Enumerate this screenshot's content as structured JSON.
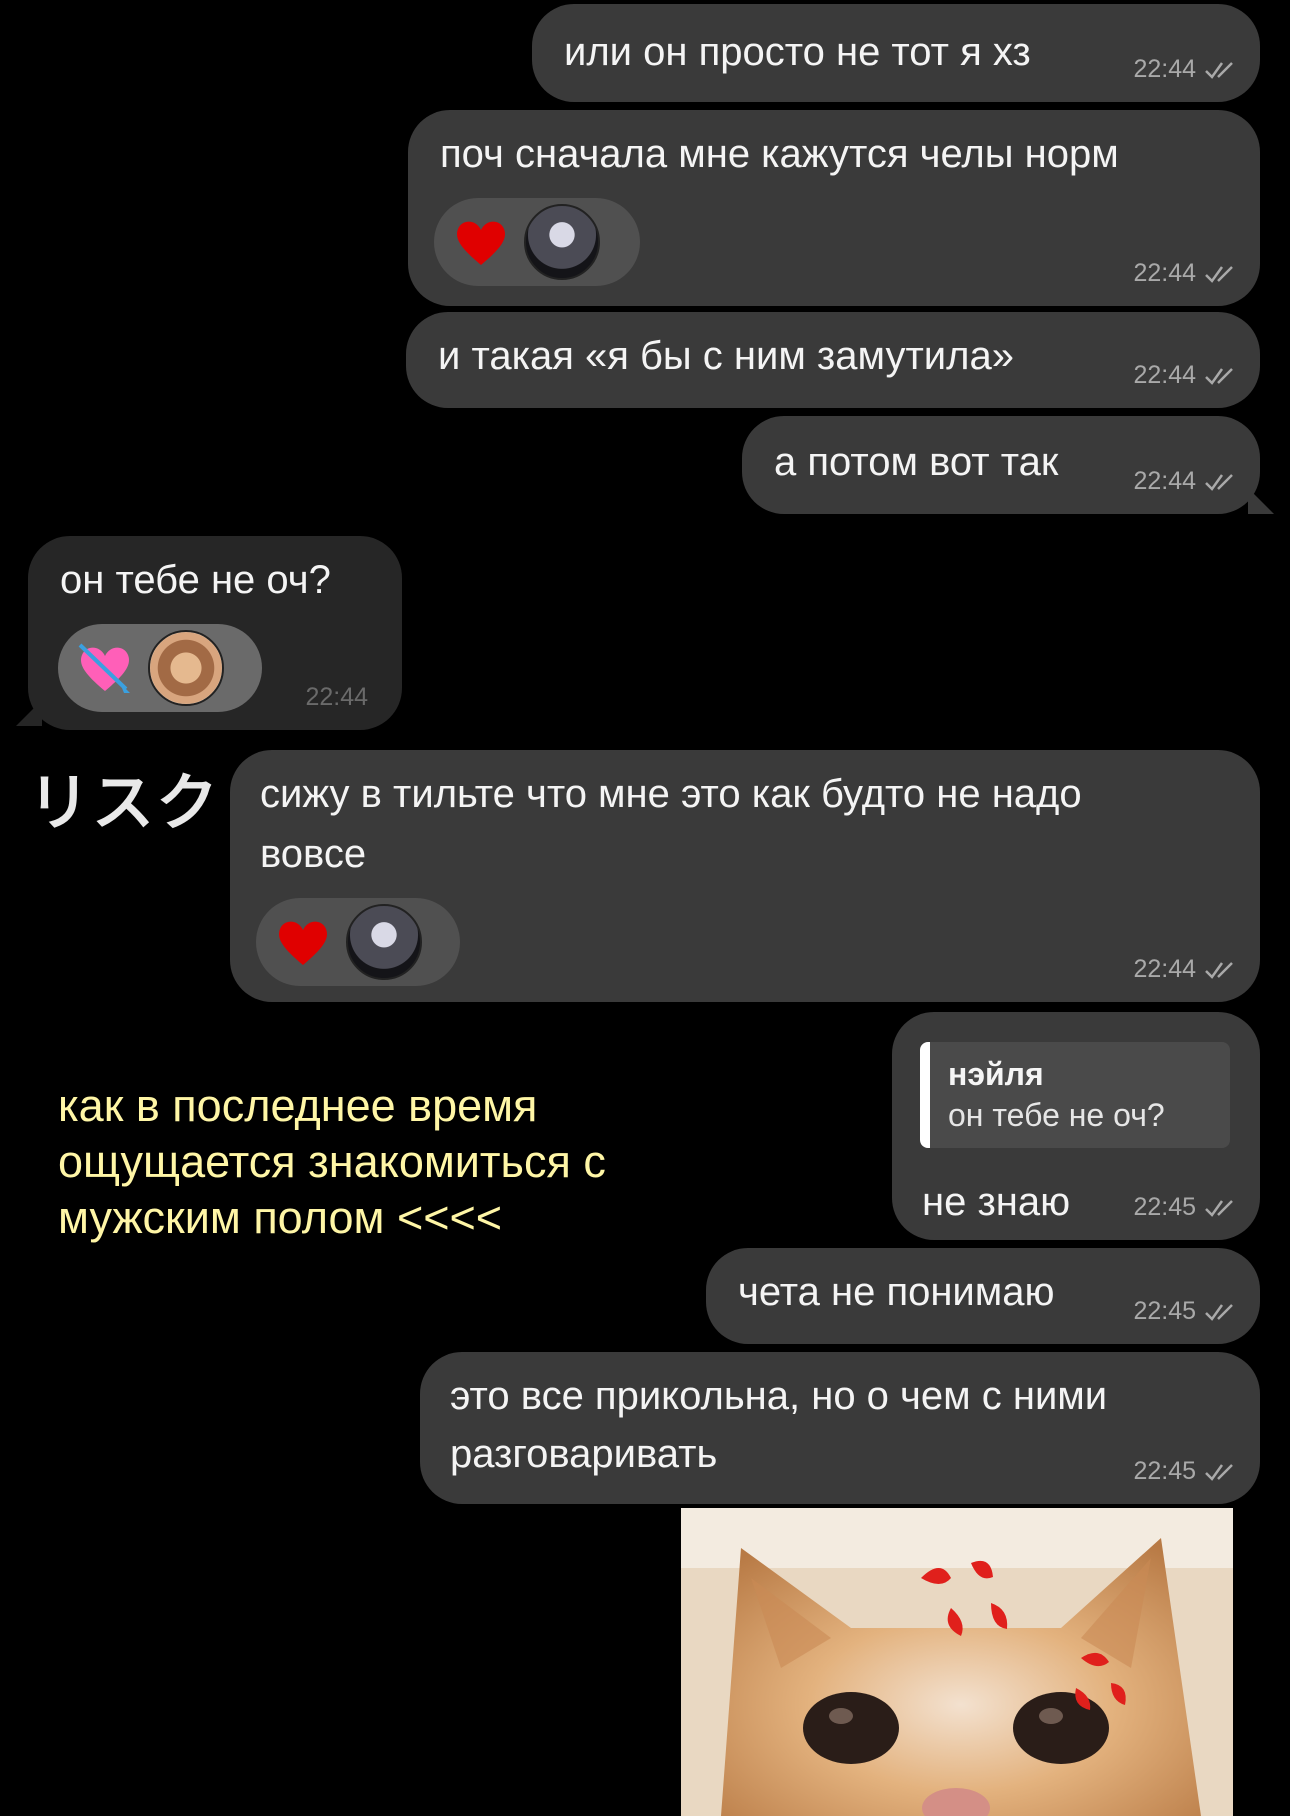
{
  "chat": {
    "messages": [
      {
        "text": "или он просто не тот я хз",
        "time": "22:44"
      },
      {
        "text": "поч сначала мне кажутся челы норм",
        "time": "22:44"
      },
      {
        "text": "и такая «я бы с ним замутила»",
        "time": "22:44"
      },
      {
        "text": "а потом вот так",
        "time": "22:44"
      },
      {
        "text": "он тебе не оч?",
        "time": "22:44"
      },
      {
        "text_line1": "сижу в тильте что мне это как будто не надо",
        "text_line2": "вовсе",
        "time": "22:44"
      },
      {
        "reply_name": "нэйля",
        "reply_text": "он тебе не оч?",
        "text": "не знаю",
        "time": "22:45"
      },
      {
        "text": "чета не понимаю",
        "time": "22:45"
      },
      {
        "text_line1": "это все прикольна, но о чем с ними",
        "text_line2": "разговаривать",
        "time": "22:45"
      }
    ],
    "reactions": {
      "heart": "red-heart-emoji",
      "arrow_heart": "heart-with-arrow-emoji"
    }
  },
  "overlay": {
    "caption_line1": "как в последнее время",
    "caption_line2": "ощущается знакомиться с",
    "caption_line3": "мужским полом <<<<",
    "japanese": "リスク",
    "caption_color": "#fff6a6"
  },
  "sticker": {
    "icon": "angry-cat-sticker"
  }
}
